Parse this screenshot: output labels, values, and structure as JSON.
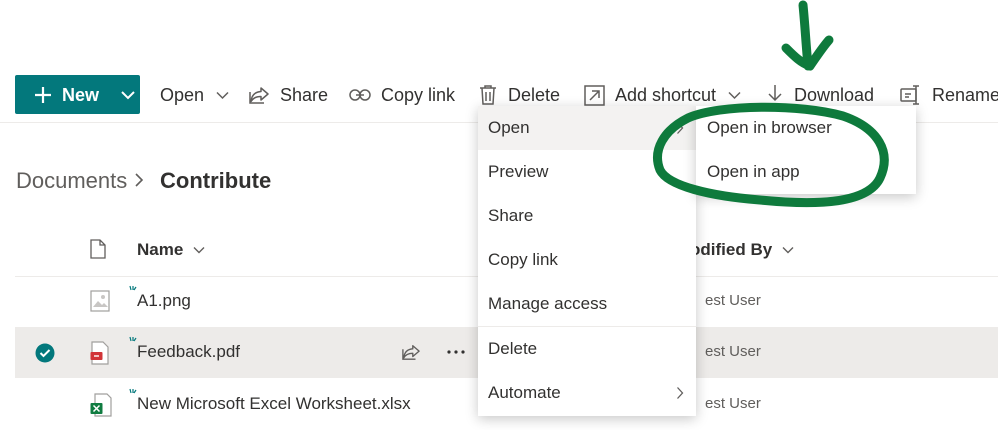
{
  "toolbar": {
    "new_label": "New",
    "open_label": "Open",
    "share_label": "Share",
    "copy_link_label": "Copy link",
    "delete_label": "Delete",
    "add_shortcut_label": "Add shortcut",
    "download_label": "Download",
    "rename_label": "Rename"
  },
  "breadcrumb": {
    "root": "Documents",
    "current": "Contribute"
  },
  "list": {
    "columns": {
      "name": "Name",
      "modified_by": "Modified By"
    },
    "visible_modified_by_header": "odified By",
    "rows": [
      {
        "name": "A1.png",
        "modified_by": "est User",
        "type": "image",
        "selected": false
      },
      {
        "name": "Feedback.pdf",
        "modified_by": "est User",
        "type": "pdf",
        "selected": true
      },
      {
        "name": "New Microsoft Excel Worksheet.xlsx",
        "modified_by": "est User",
        "type": "excel",
        "selected": false
      }
    ]
  },
  "context_menu": {
    "items": [
      {
        "label": "Open",
        "has_submenu": true,
        "hover": true
      },
      {
        "label": "Preview"
      },
      {
        "label": "Share"
      },
      {
        "label": "Copy link"
      },
      {
        "label": "Manage access"
      },
      {
        "label": "Delete"
      },
      {
        "label": "Automate",
        "has_submenu": true
      }
    ]
  },
  "open_submenu": {
    "items": [
      {
        "label": "Open in browser"
      },
      {
        "label": "Open in app"
      }
    ]
  },
  "colors": {
    "accent": "#03787c",
    "annotation": "#0e7a3c",
    "selected_row": "#edebe9"
  },
  "icons": {
    "new": "plus-icon",
    "open": "chevron-down-icon",
    "share": "share-icon",
    "copy_link": "link-icon",
    "delete": "trash-icon",
    "add_shortcut": "shortcut-icon",
    "download": "download-icon",
    "rename": "rename-icon"
  }
}
